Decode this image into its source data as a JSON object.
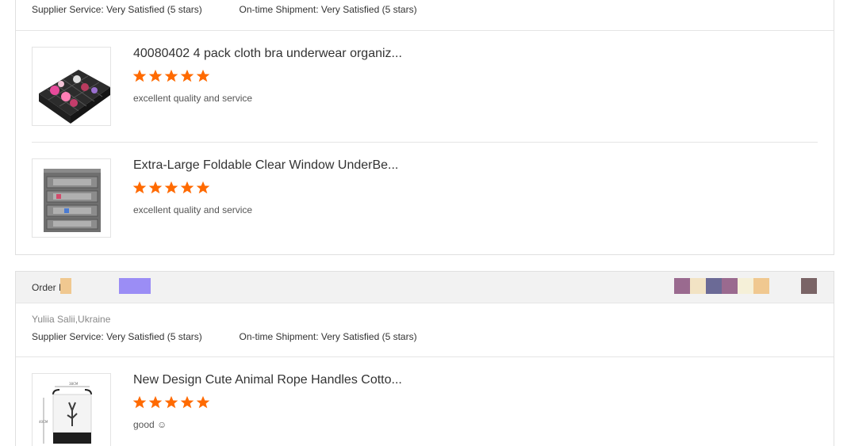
{
  "reviews": [
    {
      "supplier_service_label": "Supplier Service:",
      "supplier_service_value": "Very Satisfied",
      "supplier_service_stars": "(5 stars)",
      "shipment_label": "On-time Shipment:",
      "shipment_value": "Very Satisfied",
      "shipment_stars": "(5 stars)",
      "products": [
        {
          "title": "40080402 4 pack cloth bra underwear organiz...",
          "rating": 5,
          "comment": "excellent quality and service",
          "thumb_icon": "drawer-organizer-icon"
        },
        {
          "title": "Extra-Large Foldable Clear Window UnderBe...",
          "rating": 5,
          "comment": "excellent quality and service",
          "thumb_icon": "storage-bag-icon"
        }
      ]
    },
    {
      "order_label": "Order N",
      "buyer": "Yuliia Salii,Ukraine",
      "supplier_service_label": "Supplier Service:",
      "supplier_service_value": "Very Satisfied",
      "supplier_service_stars": "(5 stars)",
      "shipment_label": "On-time Shipment:",
      "shipment_value": "Very Satisfied",
      "shipment_stars": "(5 stars)",
      "products": [
        {
          "title": "New Design Cute Animal Rope Handles Cotto...",
          "rating": 5,
          "comment": "good ☺",
          "thumb_icon": "laundry-basket-icon"
        }
      ]
    }
  ],
  "colors": {
    "star": "#ff6a00",
    "redaction_blocks": [
      "#f0c890",
      "#9b8df5",
      "#9a6a8f",
      "#f2e3c4",
      "#6b6a96",
      "#9a6a8f",
      "#f5f0d8",
      "#f0c890",
      "#7a6466"
    ]
  }
}
